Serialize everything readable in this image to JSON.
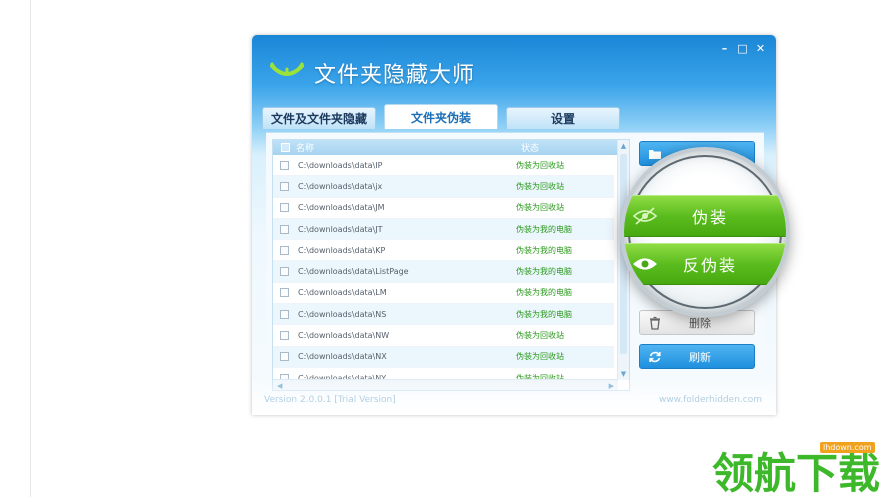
{
  "app": {
    "title": "文件夹隐藏大师"
  },
  "window_controls": {
    "minimize": "–",
    "maximize": "□",
    "close": "✕"
  },
  "tabs": [
    {
      "label": "文件及文件夹隐藏",
      "active": false
    },
    {
      "label": "文件夹伪装",
      "active": true
    },
    {
      "label": "设置",
      "active": false
    }
  ],
  "list": {
    "columns": {
      "name": "名称",
      "status": "状态"
    },
    "rows": [
      {
        "path": "C:\\downloads\\data\\IP",
        "status": "伪装为回收站"
      },
      {
        "path": "C:\\downloads\\data\\jx",
        "status": "伪装为回收站"
      },
      {
        "path": "C:\\downloads\\data\\JM",
        "status": "伪装为回收站"
      },
      {
        "path": "C:\\downloads\\data\\JT",
        "status": "伪装为我的电脑"
      },
      {
        "path": "C:\\downloads\\data\\KP",
        "status": "伪装为我的电脑"
      },
      {
        "path": "C:\\downloads\\data\\ListPage",
        "status": "伪装为我的电脑"
      },
      {
        "path": "C:\\downloads\\data\\LM",
        "status": "伪装为我的电脑"
      },
      {
        "path": "C:\\downloads\\data\\NS",
        "status": "伪装为我的电脑"
      },
      {
        "path": "C:\\downloads\\data\\NW",
        "status": "伪装为回收站"
      },
      {
        "path": "C:\\downloads\\data\\NX",
        "status": "伪装为回收站"
      },
      {
        "path": "C:\\downloads\\data\\NY",
        "status": "伪装为回收站"
      }
    ]
  },
  "side_buttons": {
    "delete_label": "删除",
    "refresh_label": "刷新"
  },
  "magnifier": {
    "disguise_label": "伪装",
    "undisguise_label": "反伪装"
  },
  "status_bar": {
    "version": "Version 2.0.0.1 [Trial Version]",
    "website": "www.folderhidden.com"
  },
  "watermark": {
    "text": "领航下载",
    "tag": "lhdown.com"
  },
  "colors": {
    "title_bar": "#1a86d6",
    "accent_green": "#5bbc1e",
    "status_text": "#2a9a1c",
    "button_blue": "#1f90de"
  }
}
